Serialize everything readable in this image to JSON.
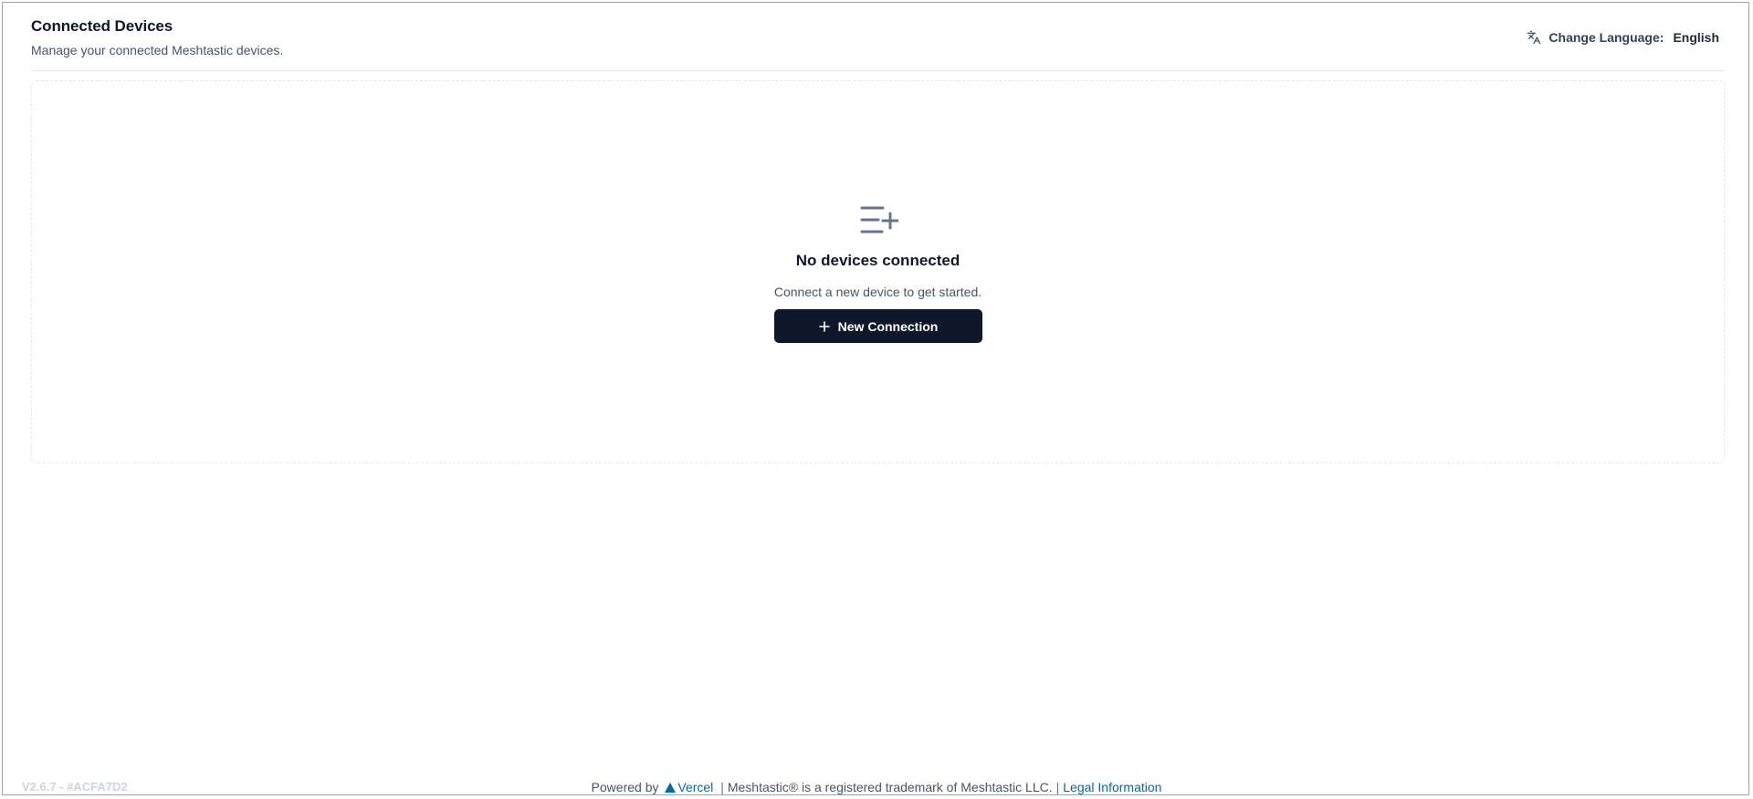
{
  "header": {
    "title": "Connected Devices",
    "subtitle": "Manage your connected Meshtastic devices.",
    "language_label": "Change Language:",
    "language_value": "English",
    "language_icon": "translate-icon"
  },
  "empty_state": {
    "icon": "list-plus-icon",
    "title": "No devices connected",
    "description": "Connect a new device to get started.",
    "button_label": "New Connection",
    "button_icon": "plus-icon"
  },
  "footer": {
    "version": "V2.6.7  -  #ACFA7D2",
    "powered_by": "Powered by",
    "vercel_label": "Vercel",
    "trademark": "Meshtastic® is a registered trademark of Meshtastic LLC.",
    "legal_label": "Legal Information",
    "separator": "|"
  },
  "colors": {
    "primary_button": "#0f172a",
    "link": "#0369a1",
    "muted_text": "#475569",
    "border": "#e5e7eb"
  }
}
